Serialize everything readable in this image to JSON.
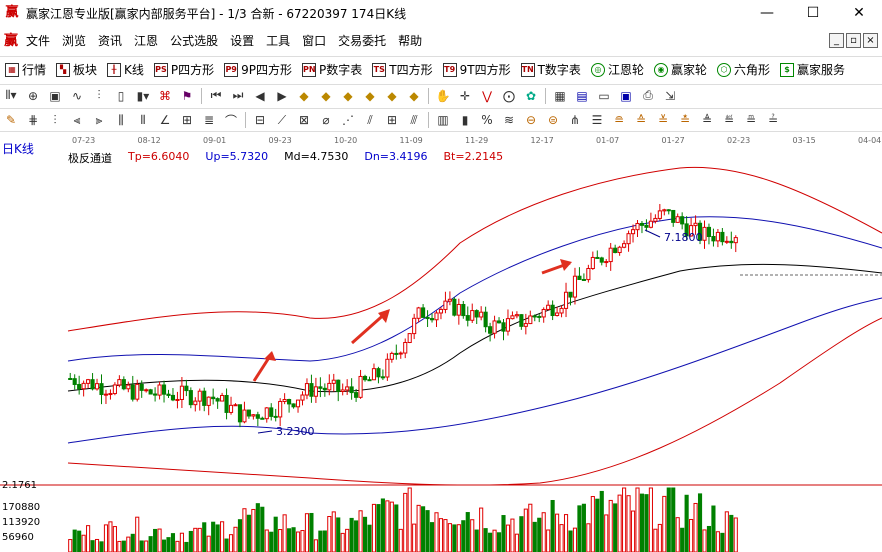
{
  "window": {
    "title": "赢家江恩专业版[赢家内部服务平台] - 1/3 合新 - 67220397 174日K线",
    "controls": [
      "—",
      "☐",
      "✕"
    ]
  },
  "menu": {
    "items": [
      "文件",
      "浏览",
      "资讯",
      "江恩",
      "公式选股",
      "设置",
      "工具",
      "窗口",
      "交易委托",
      "帮助"
    ],
    "mdi": [
      "_",
      "▫",
      "×"
    ]
  },
  "toolbar1": {
    "items": [
      {
        "label": "行情",
        "icon": "quote-table-icon"
      },
      {
        "label": "板块",
        "icon": "sector-icon"
      },
      {
        "label": "K线",
        "icon": "kline-icon"
      },
      {
        "label": "P四方形",
        "icon": "p-square-icon"
      },
      {
        "label": "9P四方形",
        "icon": "9p-square-icon"
      },
      {
        "label": "P数字表",
        "icon": "p-number-icon"
      },
      {
        "label": "T四方形",
        "icon": "t-square-icon"
      },
      {
        "label": "9T四方形",
        "icon": "9t-square-icon"
      },
      {
        "label": "T数字表",
        "icon": "t-number-icon"
      },
      {
        "label": "江恩轮",
        "icon": "gann-wheel-icon"
      },
      {
        "label": "赢家轮",
        "icon": "winner-wheel-icon"
      },
      {
        "label": "六角形",
        "icon": "hexagon-icon"
      },
      {
        "label": "赢家服务",
        "icon": "service-icon"
      }
    ]
  },
  "chart": {
    "period_label": "日K线",
    "indicator": {
      "name": "极反通道",
      "tp": "Tp=6.6040",
      "up": "Up=5.7320",
      "md": "Md=4.7530",
      "dn": "Dn=3.4196",
      "bt": "Bt=2.2145"
    },
    "dates": [
      "07-23",
      "08-12",
      "09-01",
      "09-23",
      "10-20",
      "11-09",
      "11-29",
      "12-17",
      "01-07",
      "01-27",
      "02-23",
      "03-15",
      "04-04"
    ],
    "annotations": {
      "high": "7.1800",
      "low": "3.2300"
    },
    "axis_values": {
      "volume_top": "2.1761",
      "v1": "170880",
      "v2": "113920",
      "v3": "56960"
    },
    "colors": {
      "up": "#e00000",
      "down": "#008000",
      "upper_band": "#d00000",
      "mid_band": "#000080",
      "lower_band": "#0000c0",
      "arrow": "#e03020"
    }
  },
  "chart_data": {
    "type": "candlestick",
    "x_labels": [
      "07-23",
      "08-12",
      "09-01",
      "09-23",
      "10-20",
      "11-09",
      "11-29",
      "12-17",
      "01-07",
      "01-27",
      "02-23"
    ],
    "close_series": [
      4.1,
      3.95,
      3.85,
      3.8,
      3.78,
      3.4,
      3.6,
      3.95,
      3.85,
      4.25,
      5.3,
      5.4,
      5.05,
      5.15,
      5.5,
      6.2,
      6.8,
      7.1,
      6.7,
      6.75
    ],
    "volume_series": [
      60000,
      75000,
      80000,
      65000,
      70000,
      120000,
      100000,
      90000,
      95000,
      140000,
      170000,
      150000,
      120000,
      110000,
      130000,
      150000,
      160000,
      170000,
      140000,
      90000
    ],
    "high_mark": 7.18,
    "low_mark": 3.23
  }
}
